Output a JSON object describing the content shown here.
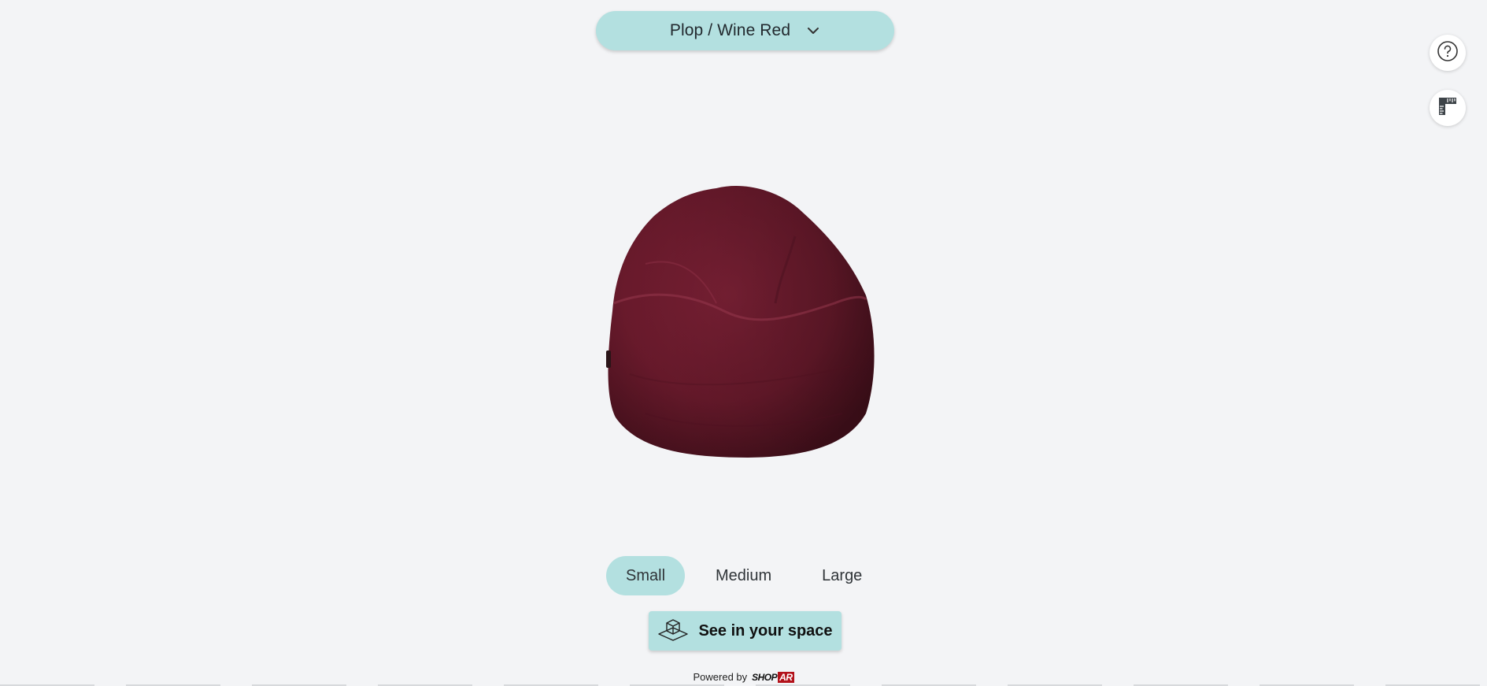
{
  "variant_selector": {
    "label": "Plop / Wine Red",
    "icon": "chevron-down-icon"
  },
  "side_controls": {
    "help_icon": "help-circle-icon",
    "measure_icon": "ruler-icon"
  },
  "viewer": {
    "product_color": "#6b1a2c"
  },
  "size_options": [
    {
      "label": "Small",
      "selected": true
    },
    {
      "label": "Medium",
      "selected": false
    },
    {
      "label": "Large",
      "selected": false
    }
  ],
  "ar_button": {
    "label": "See in your space",
    "icon": "ar-cube-icon"
  },
  "footer": {
    "powered_label": "Powered by",
    "brand_part1": "SHOP",
    "brand_part2": "AR"
  },
  "colors": {
    "accent": "#b3e0e0",
    "background": "#f3f4f6"
  }
}
